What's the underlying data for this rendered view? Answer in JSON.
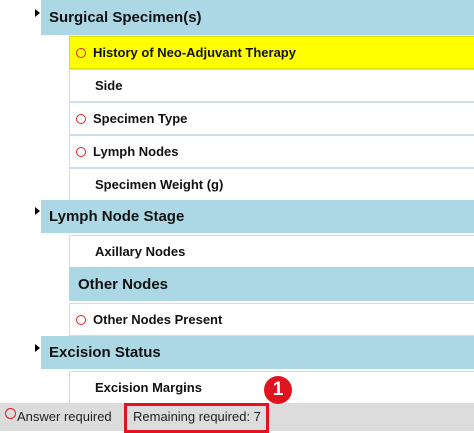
{
  "sections": [
    {
      "title": "Surgical Specimen(s)",
      "items": [
        {
          "label": "History of Neo-Adjuvant Therapy",
          "required": true,
          "highlighted": true
        },
        {
          "label": "Side",
          "required": false
        },
        {
          "label": "Specimen Type",
          "required": true
        },
        {
          "label": "Lymph Nodes",
          "required": true
        },
        {
          "label": "Specimen Weight (g)",
          "required": false
        }
      ]
    },
    {
      "title": "Lymph Node Stage",
      "items": [
        {
          "label": "Axillary Nodes",
          "required": false
        }
      ],
      "subsection": {
        "title": "Other Nodes",
        "items": [
          {
            "label": "Other Nodes Present",
            "required": true
          }
        ]
      }
    },
    {
      "title": "Excision Status",
      "items": [
        {
          "label": "Excision Margins",
          "required": false
        }
      ]
    }
  ],
  "footer": {
    "legend_label": "Answer required",
    "remaining_label": "Remaining required: 7"
  },
  "annotation_badge": "1",
  "colors": {
    "section_bg": "#acd8e6",
    "highlight": "#ffff00",
    "required_ring": "#e02020",
    "annotation_red": "#e0141e",
    "footer_bg": "#dcdcdc"
  }
}
